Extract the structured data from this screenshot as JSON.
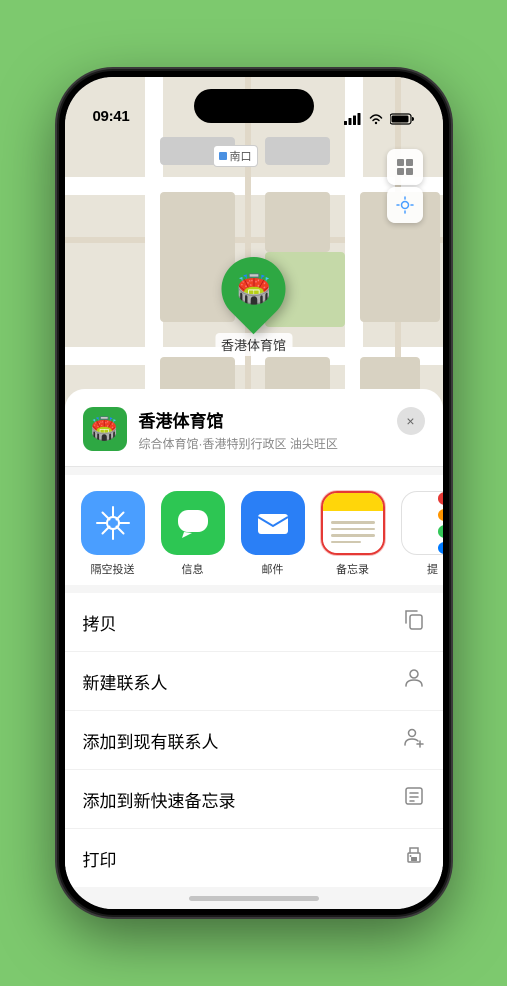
{
  "status_bar": {
    "time": "09:41",
    "signal_icon": "signal-icon",
    "wifi_icon": "wifi-icon",
    "battery_icon": "battery-icon"
  },
  "map": {
    "label_text": "南口",
    "stadium_label": "香港体育馆"
  },
  "venue": {
    "name": "香港体育馆",
    "subtitle": "综合体育馆·香港特别行政区 油尖旺区",
    "close_label": "×"
  },
  "share_items": [
    {
      "id": "airdrop",
      "label": "隔空投送",
      "type": "airdrop"
    },
    {
      "id": "messages",
      "label": "信息",
      "type": "messages"
    },
    {
      "id": "mail",
      "label": "邮件",
      "type": "mail"
    },
    {
      "id": "notes",
      "label": "备忘录",
      "type": "notes"
    },
    {
      "id": "more",
      "label": "提",
      "type": "more"
    }
  ],
  "action_items": [
    {
      "label": "拷贝",
      "icon": "copy"
    },
    {
      "label": "新建联系人",
      "icon": "person"
    },
    {
      "label": "添加到现有联系人",
      "icon": "person-add"
    },
    {
      "label": "添加到新快速备忘录",
      "icon": "memo"
    },
    {
      "label": "打印",
      "icon": "print"
    }
  ]
}
